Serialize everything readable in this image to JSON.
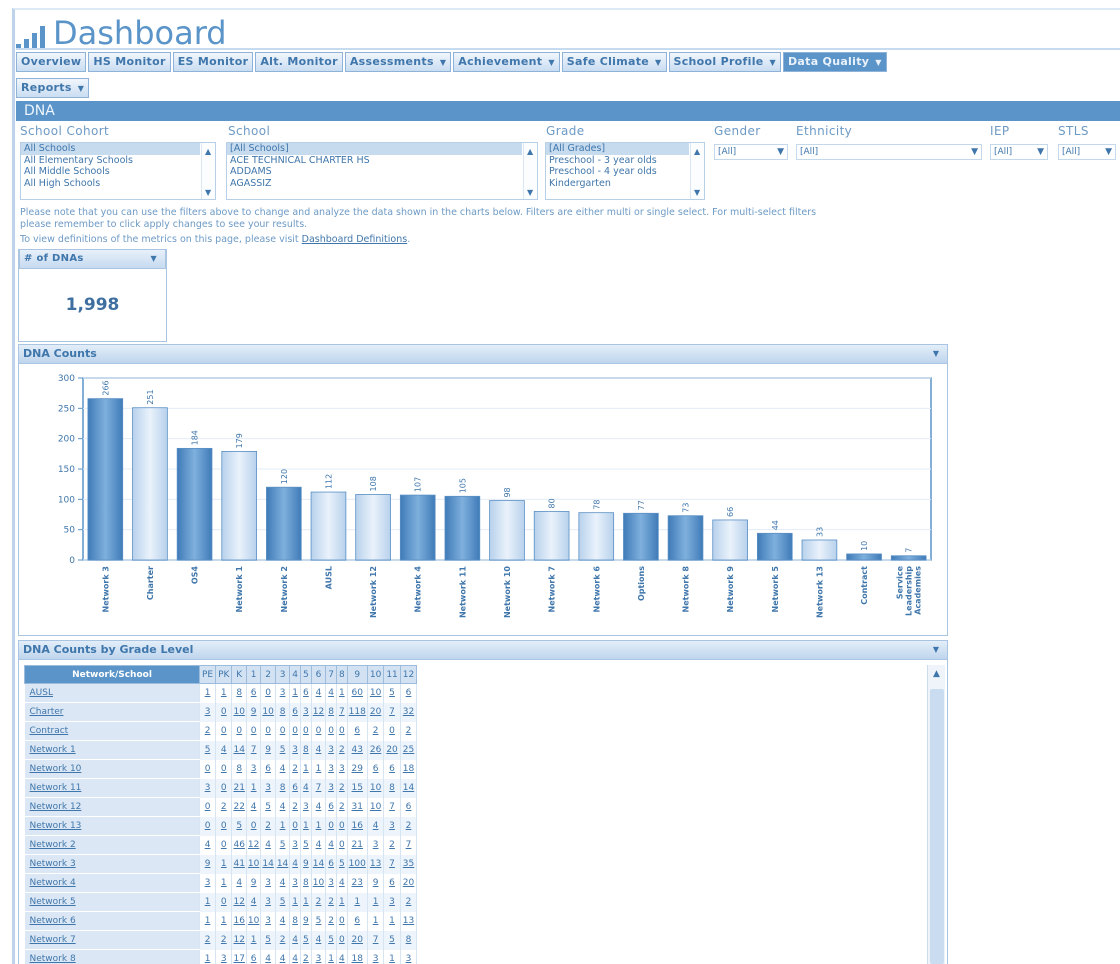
{
  "header": {
    "title": "Dashboard"
  },
  "tabs_row1": [
    {
      "label": "Overview",
      "dropdown": false,
      "active": false
    },
    {
      "label": "HS Monitor",
      "dropdown": false,
      "active": false
    },
    {
      "label": "ES Monitor",
      "dropdown": false,
      "active": false
    },
    {
      "label": "Alt. Monitor",
      "dropdown": false,
      "active": false
    },
    {
      "label": "Assessments",
      "dropdown": true,
      "active": false
    },
    {
      "label": "Achievement",
      "dropdown": true,
      "active": false
    },
    {
      "label": "Safe Climate",
      "dropdown": true,
      "active": false
    },
    {
      "label": "School Profile",
      "dropdown": true,
      "active": false
    },
    {
      "label": "Data Quality",
      "dropdown": true,
      "active": true
    }
  ],
  "tabs_row2": [
    {
      "label": "Reports",
      "dropdown": true,
      "active": false
    }
  ],
  "section_title": "DNA",
  "filters": {
    "cohort": {
      "label": "School Cohort",
      "options": [
        "All Schools",
        "All Elementary Schools",
        "All Middle Schools",
        "All High Schools"
      ],
      "selected": 0
    },
    "school": {
      "label": "School",
      "options": [
        "[All Schools]",
        "ACE TECHNICAL CHARTER HS",
        "ADDAMS",
        "AGASSIZ"
      ],
      "selected": 0
    },
    "grade": {
      "label": "Grade",
      "options": [
        "[All Grades]",
        "Preschool - 3 year olds",
        "Preschool - 4 year olds",
        "Kindergarten"
      ],
      "selected": 0
    },
    "gender": {
      "label": "Gender",
      "value": "[All]"
    },
    "ethnicity": {
      "label": "Ethnicity",
      "value": "[All]"
    },
    "iep": {
      "label": "IEP",
      "value": "[All]"
    },
    "stls": {
      "label": "STLS",
      "value": "[All]"
    }
  },
  "notes": {
    "line1": "Please note that you can use the filters above to change and analyze the data shown in the charts below. Filters are either multi or single select. For multi-select filters",
    "line2": "please remember to click apply changes to see your results.",
    "line3_prefix": "To view definitions of the metrics on this page, please visit ",
    "line3_link": "Dashboard Definitions",
    "line3_suffix": "."
  },
  "kpi": {
    "title": "# of DNAs",
    "value": "1,998"
  },
  "chart_panel": {
    "title": "DNA Counts"
  },
  "chart_data": {
    "type": "bar",
    "categories": [
      "Network 3",
      "Charter",
      "OS4",
      "Network 1",
      "Network 2",
      "AUSL",
      "Network 12",
      "Network 4",
      "Network 11",
      "Network 10",
      "Network 7",
      "Network 6",
      "Options",
      "Network 8",
      "Network 9",
      "Network 5",
      "Network 13",
      "Contract",
      "Service Leadership Academies"
    ],
    "values": [
      266,
      251,
      184,
      179,
      120,
      112,
      108,
      107,
      105,
      98,
      80,
      78,
      77,
      73,
      66,
      44,
      33,
      10,
      7
    ],
    "ylim": [
      0,
      300
    ],
    "yticks": [
      0,
      50,
      100,
      150,
      200,
      250,
      300
    ],
    "grid": true,
    "colors": {
      "dark": "#4d86bf",
      "light": "#d6e6f5"
    }
  },
  "table_panel": {
    "title": "DNA Counts by Grade Level"
  },
  "grade_table": {
    "header_name": "Network/School",
    "grade_cols": [
      "PE",
      "PK",
      "K",
      "1",
      "2",
      "3",
      "4",
      "5",
      "6",
      "7",
      "8",
      "9",
      "10",
      "11",
      "12"
    ],
    "rows": [
      {
        "name": "AUSL",
        "cells": [
          "1",
          "1",
          "8",
          "6",
          "0",
          "3",
          "1",
          "6",
          "4",
          "4",
          "1",
          "60",
          "10",
          "5",
          "6"
        ]
      },
      {
        "name": "Charter",
        "cells": [
          "3",
          "0",
          "10",
          "9",
          "10",
          "8",
          "6",
          "3",
          "12",
          "8",
          "7",
          "118",
          "20",
          "7",
          "32"
        ]
      },
      {
        "name": "Contract",
        "cells": [
          "2",
          "0",
          "0",
          "0",
          "0",
          "0",
          "0",
          "0",
          "0",
          "0",
          "0",
          "6",
          "2",
          "0",
          "2"
        ]
      },
      {
        "name": "Network 1",
        "cells": [
          "5",
          "4",
          "14",
          "7",
          "9",
          "5",
          "3",
          "8",
          "4",
          "3",
          "2",
          "43",
          "26",
          "20",
          "25"
        ]
      },
      {
        "name": "Network 10",
        "cells": [
          "0",
          "0",
          "8",
          "3",
          "6",
          "4",
          "2",
          "1",
          "1",
          "3",
          "3",
          "29",
          "6",
          "6",
          "18"
        ]
      },
      {
        "name": "Network 11",
        "cells": [
          "3",
          "0",
          "21",
          "1",
          "3",
          "8",
          "6",
          "4",
          "7",
          "3",
          "2",
          "15",
          "10",
          "8",
          "14"
        ]
      },
      {
        "name": "Network 12",
        "cells": [
          "0",
          "2",
          "22",
          "4",
          "5",
          "4",
          "2",
          "3",
          "4",
          "6",
          "2",
          "31",
          "10",
          "7",
          "6"
        ]
      },
      {
        "name": "Network 13",
        "cells": [
          "0",
          "0",
          "5",
          "0",
          "2",
          "1",
          "0",
          "1",
          "1",
          "0",
          "0",
          "16",
          "4",
          "3",
          "2"
        ]
      },
      {
        "name": "Network 2",
        "cells": [
          "4",
          "0",
          "46",
          "12",
          "4",
          "5",
          "3",
          "5",
          "4",
          "4",
          "0",
          "21",
          "3",
          "2",
          "7"
        ]
      },
      {
        "name": "Network 3",
        "cells": [
          "9",
          "1",
          "41",
          "10",
          "14",
          "14",
          "4",
          "9",
          "14",
          "6",
          "5",
          "100",
          "13",
          "7",
          "35"
        ]
      },
      {
        "name": "Network 4",
        "cells": [
          "3",
          "1",
          "4",
          "9",
          "3",
          "4",
          "3",
          "8",
          "10",
          "3",
          "4",
          "23",
          "9",
          "6",
          "20"
        ]
      },
      {
        "name": "Network 5",
        "cells": [
          "1",
          "0",
          "12",
          "4",
          "3",
          "5",
          "1",
          "1",
          "2",
          "2",
          "1",
          "1",
          "1",
          "3",
          "2"
        ]
      },
      {
        "name": "Network 6",
        "cells": [
          "1",
          "1",
          "16",
          "10",
          "3",
          "4",
          "8",
          "9",
          "5",
          "2",
          "0",
          "6",
          "1",
          "1",
          "13"
        ]
      },
      {
        "name": "Network 7",
        "cells": [
          "2",
          "2",
          "12",
          "1",
          "5",
          "2",
          "4",
          "5",
          "4",
          "5",
          "0",
          "20",
          "7",
          "5",
          "8"
        ]
      },
      {
        "name": "Network 8",
        "cells": [
          "1",
          "3",
          "17",
          "6",
          "4",
          "4",
          "4",
          "2",
          "3",
          "1",
          "4",
          "18",
          "3",
          "1",
          "3"
        ]
      }
    ]
  },
  "icons": {
    "dropdown": "caret-down-icon",
    "scroll_up": "caret-up-icon",
    "brand": "bar-chart-icon"
  }
}
